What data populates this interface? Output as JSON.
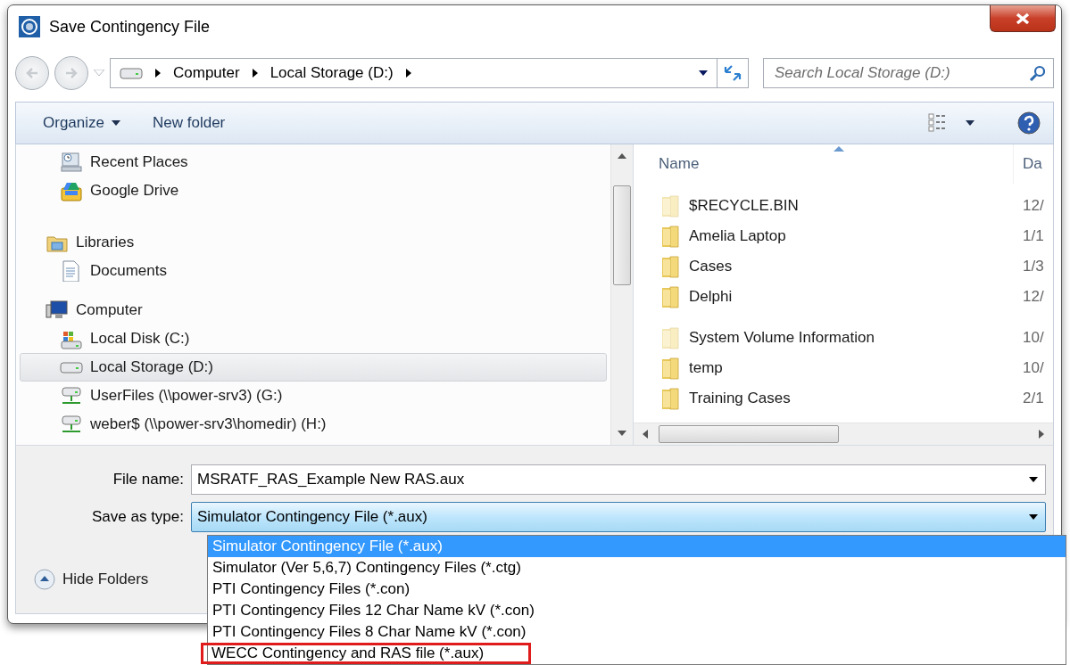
{
  "window": {
    "title": "Save Contingency File"
  },
  "address_bar": {
    "crumbs": [
      "Computer",
      "Local Storage (D:)"
    ]
  },
  "search": {
    "placeholder": "Search Local Storage (D:)"
  },
  "toolbar": {
    "organize": "Organize",
    "new_folder": "New folder"
  },
  "nav_pane": {
    "favorites": [
      {
        "label": "Recent Places",
        "kind": "recent",
        "selected": false
      },
      {
        "label": "Google Drive",
        "kind": "cloud-drive",
        "selected": false
      }
    ],
    "tree": [
      {
        "label": "Libraries",
        "kind": "library",
        "selected": false,
        "children": [
          {
            "label": "Documents",
            "kind": "document",
            "selected": false
          }
        ]
      },
      {
        "label": "Computer",
        "kind": "computer",
        "selected": false,
        "children": [
          {
            "label": "Local Disk (C:)",
            "kind": "system-disk",
            "selected": false
          },
          {
            "label": "Local Storage (D:)",
            "kind": "disk",
            "selected": true
          },
          {
            "label": "UserFiles (\\\\power-srv3) (G:)",
            "kind": "network-drive",
            "selected": false
          },
          {
            "label": "weber$ (\\\\power-srv3\\homedir) (H:)",
            "kind": "network-drive",
            "selected": false
          }
        ]
      }
    ]
  },
  "file_list": {
    "columns": [
      "Name",
      "Da"
    ],
    "rows": [
      {
        "name": "$RECYCLE.BIN",
        "date": "12/",
        "hidden": true
      },
      {
        "name": "Amelia Laptop",
        "date": "1/1",
        "hidden": false
      },
      {
        "name": "Cases",
        "date": "1/3",
        "hidden": false
      },
      {
        "name": "Delphi",
        "date": "12/",
        "hidden": false
      },
      {
        "name": "System Volume Information",
        "date": "10/",
        "hidden": true
      },
      {
        "name": "temp",
        "date": "10/",
        "hidden": false
      },
      {
        "name": "Training Cases",
        "date": "2/1",
        "hidden": false
      }
    ]
  },
  "file_name": {
    "label": "File name:",
    "value": "MSRATF_RAS_Example New RAS.aux"
  },
  "save_as_type": {
    "label": "Save as type:",
    "value": "Simulator Contingency File (*.aux)",
    "expanded": true,
    "options": [
      {
        "label": "Simulator Contingency File (*.aux)",
        "selected": true,
        "highlighted": false
      },
      {
        "label": "Simulator (Ver 5,6,7) Contingency Files (*.ctg)",
        "selected": false,
        "highlighted": false
      },
      {
        "label": "PTI Contingency Files (*.con)",
        "selected": false,
        "highlighted": false
      },
      {
        "label": "PTI Contingency Files 12 Char Name kV (*.con)",
        "selected": false,
        "highlighted": false
      },
      {
        "label": "PTI Contingency Files 8 Char Name kV (*.con)",
        "selected": false,
        "highlighted": false
      },
      {
        "label": "WECC Contingency and RAS file (*.aux)",
        "selected": false,
        "highlighted": true
      }
    ]
  },
  "hide_folders": "Hide Folders"
}
